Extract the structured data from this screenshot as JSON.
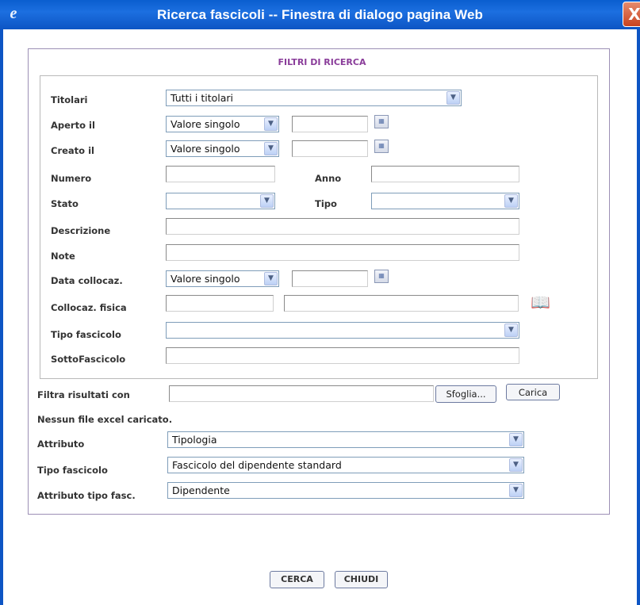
{
  "window": {
    "title": "Ricerca fascicoli -- Finestra di dialogo pagina Web",
    "app_icon": "ie-icon",
    "close_glyph": "X"
  },
  "panel": {
    "title": "FILTRI DI RICERCA"
  },
  "filters": {
    "titolari": {
      "label": "Titolari",
      "value": "Tutti i titolari"
    },
    "aperto_il": {
      "label": "Aperto il",
      "mode": "Valore singolo",
      "date": ""
    },
    "creato_il": {
      "label": "Creato il",
      "mode": "Valore singolo",
      "date": ""
    },
    "numero": {
      "label": "Numero",
      "value": ""
    },
    "anno": {
      "label": "Anno",
      "value": ""
    },
    "stato": {
      "label": "Stato",
      "value": ""
    },
    "tipo": {
      "label": "Tipo",
      "value": ""
    },
    "descrizione": {
      "label": "Descrizione",
      "value": ""
    },
    "note": {
      "label": "Note",
      "value": ""
    },
    "data_collocaz": {
      "label": "Data collocaz.",
      "mode": "Valore singolo",
      "date": ""
    },
    "collocaz_fisica": {
      "label": "Collocaz. fisica",
      "value1": "",
      "value2": ""
    },
    "tipo_fascicolo": {
      "label": "Tipo fascicolo",
      "value": ""
    },
    "sotto_fascicolo": {
      "label": "SottoFascicolo",
      "value": ""
    }
  },
  "upload": {
    "label": "Filtra risultati con",
    "file_value": "",
    "browse_label": "Sfoglia...",
    "load_label": "Carica",
    "status": "Nessun file excel caricato."
  },
  "extra": {
    "attributo": {
      "label": "Attributo",
      "value": "Tipologia"
    },
    "tipo_fascicolo": {
      "label": "Tipo fascicolo",
      "value": "Fascicolo del dipendente standard"
    },
    "attributo_tipo_fasc": {
      "label": "Attributo tipo fasc.",
      "value": "Dipendente"
    }
  },
  "actions": {
    "search_label": "CERCA",
    "close_label": "CHIUDI"
  },
  "colors": {
    "titlebar": "#0d55c4",
    "panel_title": "#8a3d9a",
    "panel_border": "#9c8fb5"
  }
}
